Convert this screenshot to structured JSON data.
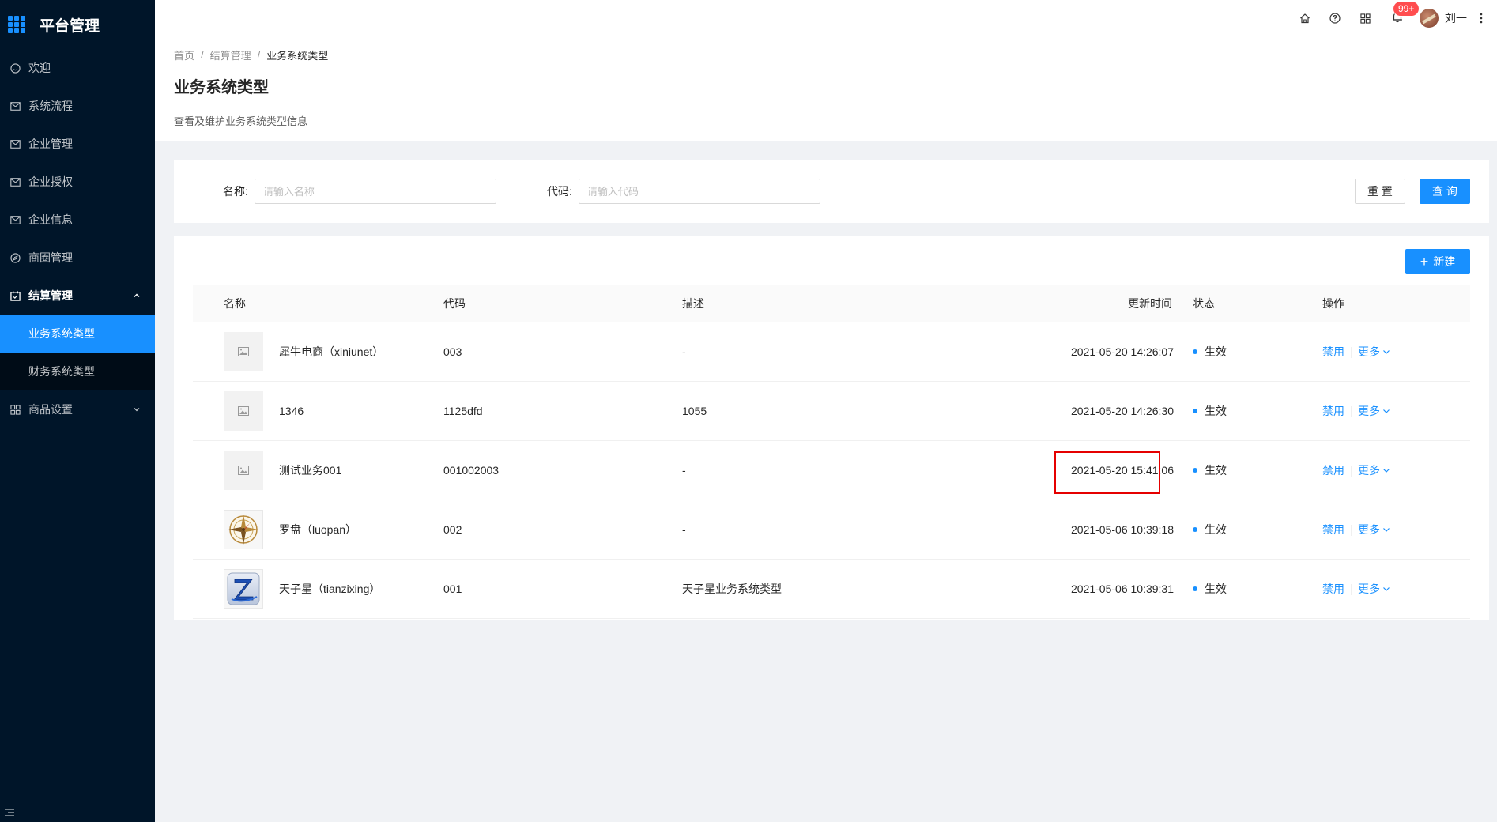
{
  "sidebar": {
    "title": "平台管理",
    "items": [
      {
        "label": "欢迎",
        "icon": "smile-icon"
      },
      {
        "label": "系统流程",
        "icon": "mail-icon"
      },
      {
        "label": "企业管理",
        "icon": "mail-icon"
      },
      {
        "label": "企业授权",
        "icon": "mail-icon"
      },
      {
        "label": "企业信息",
        "icon": "mail-icon"
      },
      {
        "label": "商圈管理",
        "icon": "compass-icon"
      }
    ],
    "settlement": {
      "label": "结算管理",
      "icon": "calendar-icon",
      "children": [
        {
          "label": "业务系统类型"
        },
        {
          "label": "财务系统类型"
        }
      ]
    },
    "product_settings": {
      "label": "商品设置",
      "icon": "appstore-icon"
    }
  },
  "header": {
    "notification_count": "99+",
    "user_name": "刘一"
  },
  "page": {
    "breadcrumb": [
      "首页",
      "结算管理",
      "业务系统类型"
    ],
    "title": "业务系统类型",
    "description": "查看及维护业务系统类型信息"
  },
  "search": {
    "name_label": "名称:",
    "name_placeholder": "请输入名称",
    "code_label": "代码:",
    "code_placeholder": "请输入代码",
    "reset": "重 置",
    "query": "查 询"
  },
  "table": {
    "new_button": "新建",
    "columns": [
      "名称",
      "代码",
      "描述",
      "更新时间",
      "状态",
      "操作"
    ],
    "rows": [
      {
        "name": "犀牛电商（xiniunet）",
        "code": "003",
        "desc": "-",
        "updated": "2021-05-20 14:26:07",
        "status": "生效",
        "thumb": "placeholder"
      },
      {
        "name": "1346",
        "code": "1125dfd",
        "desc": "1055",
        "updated": "2021-05-20 14:26:30",
        "status": "生效",
        "thumb": "placeholder"
      },
      {
        "name": "测试业务001",
        "code": "001002003",
        "desc": "-",
        "updated": "2021-05-20 15:41:06",
        "status": "生效",
        "thumb": "placeholder"
      },
      {
        "name": "罗盘（luopan）",
        "code": "002",
        "desc": "-",
        "updated": "2021-05-06 10:39:18",
        "status": "生效",
        "thumb": "compass"
      },
      {
        "name": "天子星（tianzixing）",
        "code": "001",
        "desc": "天子星业务系统类型",
        "updated": "2021-05-06 10:39:31",
        "status": "生效",
        "thumb": "z-logo"
      }
    ],
    "op_disable": "禁用",
    "op_more": "更多"
  },
  "colors": {
    "primary": "#1890ff",
    "sidebar_bg": "#001529",
    "highlight": "#e50000",
    "badge": "#ff4d4f"
  }
}
